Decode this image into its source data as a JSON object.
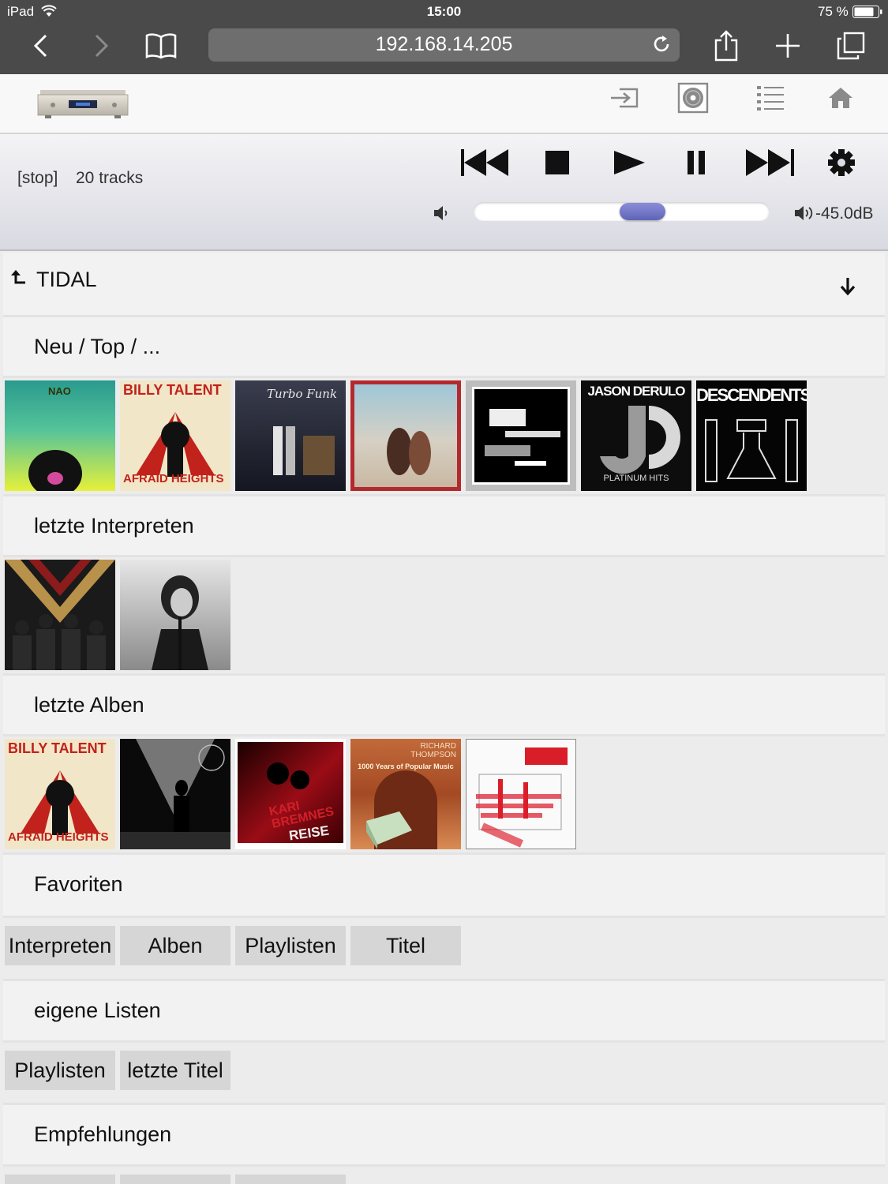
{
  "status_bar": {
    "device": "iPad",
    "time": "15:00",
    "battery": "75 %"
  },
  "browser": {
    "url": "192.168.14.205"
  },
  "player": {
    "state": "[stop]",
    "track_count": "20 tracks",
    "volume_level": "-45.0dB",
    "volume_position": 0.57
  },
  "browse": {
    "source_title": "TIDAL",
    "sections": {
      "new_top": {
        "title": "Neu / Top / ..."
      },
      "recent_artists": {
        "title": "letzte Interpreten"
      },
      "recent_albums": {
        "title": "letzte Alben"
      },
      "favorites": {
        "title": "Favoriten",
        "buttons": [
          "Interpreten",
          "Alben",
          "Playlisten",
          "Titel"
        ]
      },
      "own_lists": {
        "title": "eigene Listen",
        "buttons": [
          "Playlisten",
          "letzte Titel"
        ]
      },
      "recommendations": {
        "title": "Empfehlungen"
      }
    },
    "new_covers": [
      {
        "text": "NAO"
      },
      {
        "text": "BILLY TALENT",
        "text2": "AFRAID HEIGHTS"
      },
      {
        "text": "Turbo Funk"
      },
      {
        "text": ""
      },
      {
        "text": ""
      },
      {
        "text": "JASON DERULO",
        "text2": "PLATINUM HITS"
      },
      {
        "text": "DESCENDENTS"
      }
    ],
    "album_covers": [
      {
        "text": "BILLY TALENT",
        "text2": "AFRAID HEIGHTS"
      },
      {
        "text": ""
      },
      {
        "text": "KARI BREMNES",
        "text2": "REISE"
      },
      {
        "text": "RICHARD THOMPSON",
        "text2": "1000 Years of Popular Music"
      },
      {
        "text": ""
      }
    ]
  },
  "colors": {
    "chrome": "#4a4a4a",
    "accent": "#6a6ec4",
    "panel": "#f2f2f2"
  }
}
